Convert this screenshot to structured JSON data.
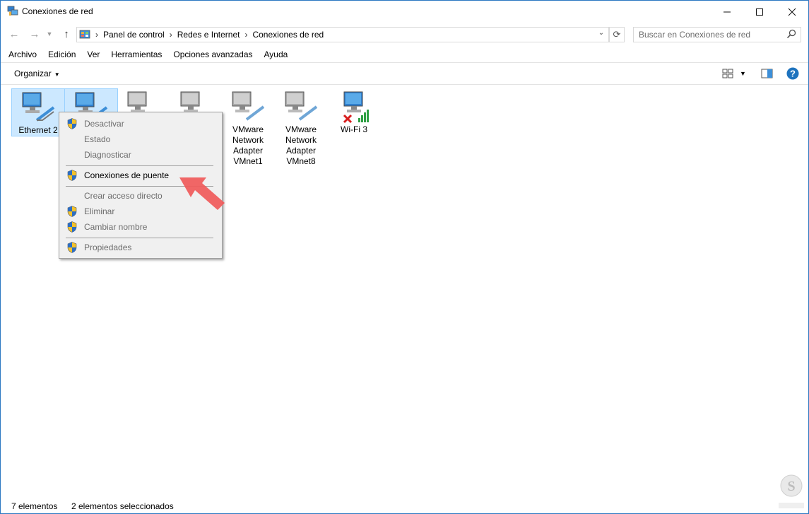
{
  "window": {
    "title": "Conexiones de red",
    "icon": "network-connections-icon"
  },
  "titlebar_buttons": [
    "minimize-icon",
    "maximize-icon",
    "close-icon"
  ],
  "address": {
    "crumbs": [
      "Panel de control",
      "Redes e Internet",
      "Conexiones de red"
    ],
    "search_placeholder": "Buscar en Conexiones de red"
  },
  "menu": [
    "Archivo",
    "Edición",
    "Ver",
    "Herramientas",
    "Opciones avanzadas",
    "Ayuda"
  ],
  "toolbar": {
    "organize_label": "Organizar"
  },
  "items": [
    {
      "label": "Ethernet 2",
      "selected": true,
      "icon": "ethernet-adapter-icon"
    },
    {
      "label": "",
      "selected": true,
      "icon": "ethernet-adapter-icon"
    },
    {
      "label": "",
      "selected": false,
      "icon": "ethernet-adapter-disabled-icon"
    },
    {
      "label": "",
      "selected": false,
      "icon": "ethernet-adapter-disabled-icon"
    },
    {
      "label": "VMware Network Adapter VMnet1",
      "selected": false,
      "icon": "ethernet-adapter-disabled-icon"
    },
    {
      "label": "VMware Network Adapter VMnet8",
      "selected": false,
      "icon": "ethernet-adapter-disabled-icon"
    },
    {
      "label": "Wi-Fi 3",
      "selected": false,
      "icon": "wifi-adapter-disconnected-icon"
    }
  ],
  "context_menu": {
    "items": [
      {
        "label": "Desactivar",
        "shield": true,
        "disabled": true
      },
      {
        "label": "Estado",
        "shield": false,
        "disabled": true
      },
      {
        "label": "Diagnosticar",
        "shield": false,
        "disabled": true
      },
      {
        "label": "Conexiones de puente",
        "shield": true,
        "disabled": false
      },
      {
        "label": "Crear acceso directo",
        "shield": false,
        "disabled": true
      },
      {
        "label": "Eliminar",
        "shield": true,
        "disabled": true
      },
      {
        "label": "Cambiar nombre",
        "shield": true,
        "disabled": true
      },
      {
        "label": "Propiedades",
        "shield": true,
        "disabled": true
      }
    ]
  },
  "status": {
    "count": "7 elementos",
    "selected": "2 elementos seleccionados"
  },
  "colors": {
    "selection_bg": "#cce8ff",
    "accent": "#1e73be",
    "annotation_arrow": "#f05a5a"
  }
}
